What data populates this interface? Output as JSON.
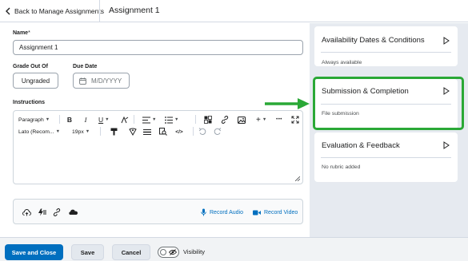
{
  "header": {
    "back_label": "Back to Manage Assignments",
    "title": "Assignment 1"
  },
  "form": {
    "name_label": "Name",
    "name_required_mark": "*",
    "name_value": "Assignment 1",
    "grade_label": "Grade Out Of",
    "grade_value": "Ungraded",
    "due_label": "Due Date",
    "due_placeholder": "M/D/YYYY",
    "instructions_label": "Instructions"
  },
  "editor": {
    "format_select": "Paragraph",
    "font_select": "Lato (Recom...",
    "size_select": "19px",
    "bold": "B",
    "italic": "I",
    "underline": "U",
    "more_label": "•••",
    "add_label": "+"
  },
  "media": {
    "record_audio": "Record Audio",
    "record_video": "Record Video"
  },
  "cards": [
    {
      "title": "Availability Dates & Conditions",
      "subtitle": "Always available"
    },
    {
      "title": "Submission & Completion",
      "subtitle": "File submission"
    },
    {
      "title": "Evaluation & Feedback",
      "subtitle": "No rubric added"
    }
  ],
  "footer": {
    "save_close": "Save and Close",
    "save": "Save",
    "cancel": "Cancel",
    "visibility": "Visibility"
  },
  "colors": {
    "primary": "#006fbf",
    "highlight": "#2aa836",
    "panel_bg": "#e6eaf0"
  },
  "icons": [
    "chevron-left-icon",
    "calendar-icon",
    "microphone-icon",
    "video-camera-icon",
    "play-triangle-icon",
    "eye-slash-icon"
  ]
}
